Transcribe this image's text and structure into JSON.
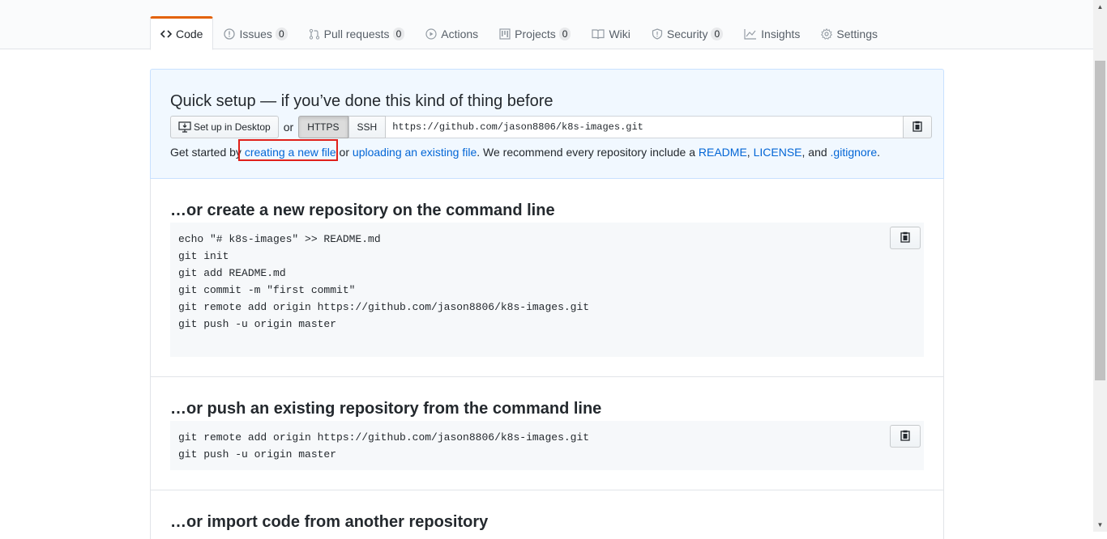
{
  "tabs": [
    {
      "label": "Code",
      "icon": "code-icon",
      "selected": true
    },
    {
      "label": "Issues",
      "icon": "issue-icon",
      "count": "0"
    },
    {
      "label": "Pull requests",
      "icon": "pull-request-icon",
      "count": "0"
    },
    {
      "label": "Actions",
      "icon": "play-icon"
    },
    {
      "label": "Projects",
      "icon": "project-icon",
      "count": "0"
    },
    {
      "label": "Wiki",
      "icon": "book-icon"
    },
    {
      "label": "Security",
      "icon": "shield-icon",
      "count": "0"
    },
    {
      "label": "Insights",
      "icon": "graph-icon"
    },
    {
      "label": "Settings",
      "icon": "gear-icon"
    }
  ],
  "quick_setup": {
    "title": "Quick setup — if you’ve done this kind of thing before",
    "desktop_button": "Set up in Desktop",
    "or": "or",
    "protocols": [
      "HTTPS",
      "SSH"
    ],
    "selected_protocol": "HTTPS",
    "clone_url": "https://github.com/jason8806/k8s-images.git",
    "getting_started": {
      "prefix": "Get started by ",
      "link_create": "creating a new file",
      "or": " or ",
      "link_upload": "uploading an existing file",
      "middle": ". We recommend every repository include a ",
      "link_readme": "README",
      "comma1": ", ",
      "link_license": "LICENSE",
      "and": ", and ",
      "link_gitignore": ".gitignore",
      "end": "."
    }
  },
  "new_repo": {
    "title": "…or create a new repository on the command line",
    "lines": [
      "echo \"# k8s-images\" >> README.md",
      "git init",
      "git add README.md",
      "git commit -m \"first commit\"",
      "git remote add origin https://github.com/jason8806/k8s-images.git",
      "git push -u origin master"
    ]
  },
  "push_existing": {
    "title": "…or push an existing repository from the command line",
    "lines": [
      "git remote add origin https://github.com/jason8806/k8s-images.git",
      "git push -u origin master"
    ]
  },
  "import_code": {
    "title": "…or import code from another repository"
  },
  "colors": {
    "link": "#0366d6",
    "tab_accent": "#e36209",
    "highlight": "#e0201b",
    "quick_setup_bg": "#f1f8ff"
  }
}
